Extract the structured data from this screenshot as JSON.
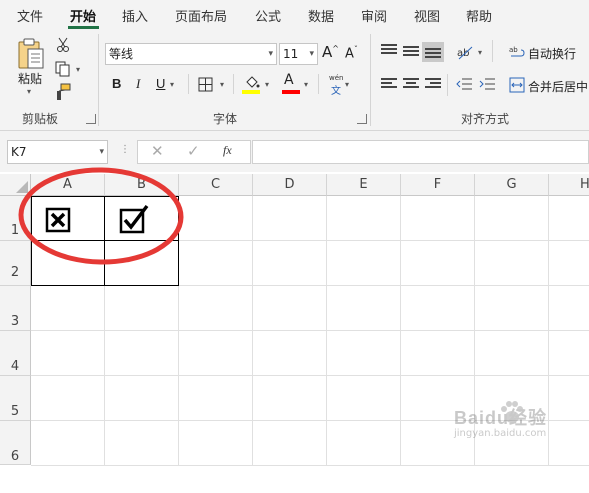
{
  "menu": {
    "tabs": [
      "文件",
      "开始",
      "插入",
      "页面布局",
      "公式",
      "数据",
      "审阅",
      "视图",
      "帮助"
    ],
    "active": "开始"
  },
  "ribbon": {
    "clipboard": {
      "paste_label": "粘贴",
      "group_label": "剪贴板"
    },
    "font": {
      "font_name": "等线",
      "font_size": "11",
      "bold": "B",
      "italic": "I",
      "underline": "U",
      "grow": "A",
      "shrink": "A",
      "font_color_glyph": "A",
      "phonetic_top": "wén",
      "phonetic_bottom": "文",
      "group_label": "字体"
    },
    "alignment": {
      "wrap_label": "自动换行",
      "merge_label": "合并后居中",
      "group_label": "对齐方式"
    },
    "colors": {
      "highlight": "#ffff00",
      "font_color": "#ff0000",
      "accent": "#217346"
    }
  },
  "formula_bar": {
    "name_box": "K7",
    "formula": "",
    "fx_label": "fx"
  },
  "sheet": {
    "columns": [
      "A",
      "B",
      "C",
      "D",
      "E",
      "F",
      "G",
      "H"
    ],
    "rows": [
      "1",
      "2",
      "3",
      "4",
      "5",
      "6"
    ],
    "cells": {
      "A1": "☒",
      "B1": "☑"
    },
    "selected_cell": "K7"
  },
  "watermark": {
    "text": "Baidu经验",
    "url_text": "jingyan.baidu.com"
  }
}
